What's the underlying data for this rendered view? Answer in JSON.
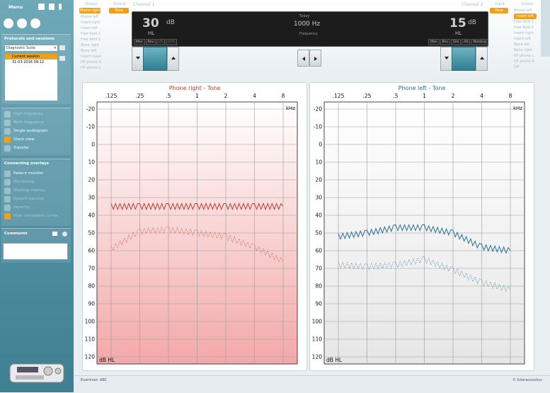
{
  "menu": {
    "title": "Menu"
  },
  "protocols": {
    "title": "Protocols and sessions",
    "selected_protocol": "Diagnostic Suite",
    "sessions": [
      "Current session",
      "31-03-2016 09:12"
    ]
  },
  "views": [
    {
      "label": "High frequency",
      "enabled": false
    },
    {
      "label": "Multi frequency",
      "enabled": false
    },
    {
      "label": "Single audiogram",
      "enabled": true,
      "icon": "single-audiogram-icon"
    },
    {
      "label": "Stack view",
      "enabled": true,
      "active": true,
      "icon": "stack-view-icon"
    },
    {
      "label": "Transfer",
      "enabled": true,
      "icon": "transfer-icon"
    }
  ],
  "overlays": {
    "title": "Connecting overlays",
    "items": [
      {
        "label": "Patient monitor",
        "enabled": true
      },
      {
        "label": "Monitoring",
        "enabled": false
      },
      {
        "label": "Masking overlay",
        "enabled": false
      },
      {
        "label": "Speech banana",
        "enabled": false
      },
      {
        "label": "Severity",
        "enabled": false
      },
      {
        "label": "Hide unmasked curves",
        "enabled": false
      }
    ]
  },
  "comments": {
    "title": "Comments"
  },
  "channel1": {
    "label": "Channel 1",
    "level": "30",
    "unit": "dB",
    "scale": "HL",
    "output_label": "Output",
    "stim_label": "Stimuli",
    "stim_value": "Tone",
    "outputs": [
      "Phone right",
      "Phone left",
      "Insert right",
      "Insert left",
      "Free field 1",
      "Free field 2",
      "Bone right",
      "Bone left",
      "Insert mask",
      "HF phone R",
      "HF phone L"
    ],
    "buttons": [
      "Man",
      "Rev",
      "⟋⟍",
      "⟋⟋⟍"
    ]
  },
  "center": {
    "top_label": "Today",
    "frequency": "1000 Hz",
    "frequency_label": "Frequency"
  },
  "channel2": {
    "label": "Channel 2",
    "level": "15",
    "unit": "dB",
    "scale": "HL",
    "input_label": "Input",
    "input_value": "Tone",
    "output_label": "Output",
    "outputs": [
      "Phone left",
      "Insert left",
      "Free field 1",
      "Free field 2",
      "Insert right",
      "Insert left",
      "Bone left",
      "Bone right",
      "HF phone L",
      "HF phone R",
      "Off"
    ],
    "buttons": [
      "Man",
      "Rev",
      "Sim",
      "Alt",
      "Masking"
    ]
  },
  "right_chart": {
    "title": "Phone right - Tone",
    "color": "#c0392b"
  },
  "left_chart": {
    "title": "Phone left - Tone",
    "color": "#2c6e9a"
  },
  "axes": {
    "freq_ticks": [
      ".125",
      ".25",
      ".5",
      "1",
      "2",
      "4",
      "8"
    ],
    "khz": "kHz",
    "db_ticks": [
      "-20",
      "-10",
      "0",
      "10",
      "20",
      "30",
      "40",
      "50",
      "60",
      "70",
      "80",
      "90",
      "100",
      "110",
      "120"
    ],
    "db_unit": "dB HL"
  },
  "chart_data": [
    {
      "type": "line",
      "title": "Phone right - Tone",
      "xlabel": "kHz",
      "ylabel": "dB HL",
      "xscale": "log",
      "ylim": [
        -20,
        120
      ],
      "y_inverted": true,
      "series": [
        {
          "name": "Phone right - Tone",
          "x": [
            0.125,
            0.25,
            0.5,
            1,
            2,
            4,
            8
          ],
          "y": [
            35,
            35,
            35,
            35,
            35,
            35,
            35
          ]
        },
        {
          "x": [
            0.125,
            0.25,
            0.5,
            1,
            2,
            4,
            8
          ],
          "y": [
            59,
            49,
            48,
            50,
            52,
            58,
            66
          ],
          "style": "dotted"
        }
      ]
    },
    {
      "type": "line",
      "title": "Phone left - Tone",
      "xlabel": "kHz",
      "ylabel": "dB HL",
      "xscale": "log",
      "ylim": [
        -20,
        120
      ],
      "y_inverted": true,
      "series": [
        {
          "name": "Phone left - Tone",
          "x": [
            0.125,
            0.25,
            0.5,
            1,
            2,
            4,
            8
          ],
          "y": [
            52,
            50,
            47,
            47,
            50,
            58,
            60
          ],
          "style": "solid"
        },
        {
          "x": [
            0.125,
            0.25,
            0.5,
            1,
            2,
            4,
            8
          ],
          "y": [
            68,
            69,
            68,
            65,
            71,
            78,
            82
          ],
          "style": "dotted"
        }
      ]
    }
  ],
  "status": {
    "examiner": "Examiner: ABC",
    "copyright": "© Interacoustics"
  }
}
